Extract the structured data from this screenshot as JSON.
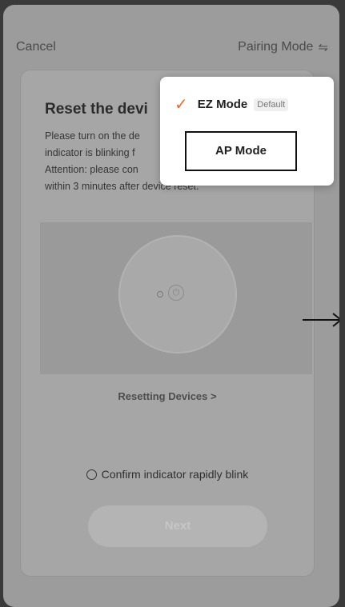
{
  "header": {
    "cancel_label": "Cancel",
    "pairing_mode_label": "Pairing Mode",
    "pairing_mode_icon": "⇋"
  },
  "card": {
    "title": "Reset the devi",
    "instructions": [
      "Please turn on the de",
      "indicator is blinking f",
      "Attention: please con",
      "within 3 minutes after device reset."
    ],
    "resetting_link": "Resetting Devices >",
    "confirm_label": "Confirm indicator rapidly blink",
    "next_label": "Next"
  },
  "pairing_menu": {
    "options": [
      {
        "label": "EZ Mode",
        "badge": "Default",
        "selected": true
      },
      {
        "label": "AP Mode",
        "selected": false
      }
    ]
  },
  "colors": {
    "accent_check": "#f36a22",
    "overlay": "#9c9c9c"
  }
}
